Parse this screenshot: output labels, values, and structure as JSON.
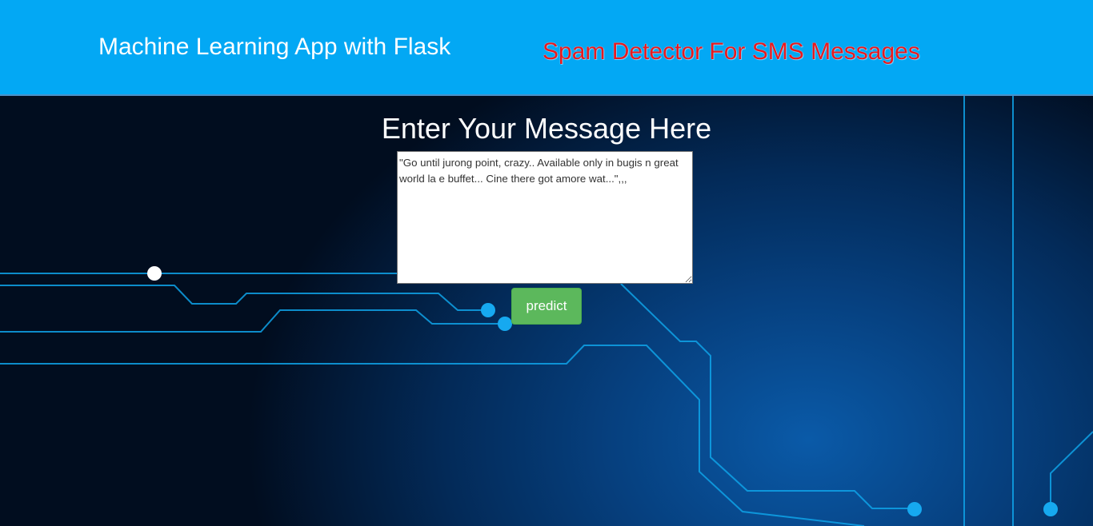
{
  "header": {
    "title": "Machine Learning App with Flask",
    "subtitle": "Spam Detector For SMS Messages",
    "background_color": "#03a8f4",
    "subtitle_color": "#e8191e"
  },
  "main": {
    "heading": "Enter Your Message Here",
    "message_value": "\"Go until jurong point, crazy.. Available only in bugis n great world la e buffet... Cine there got amore wat...\",,,",
    "predict_label": "predict",
    "predict_color": "#5cb85c"
  }
}
